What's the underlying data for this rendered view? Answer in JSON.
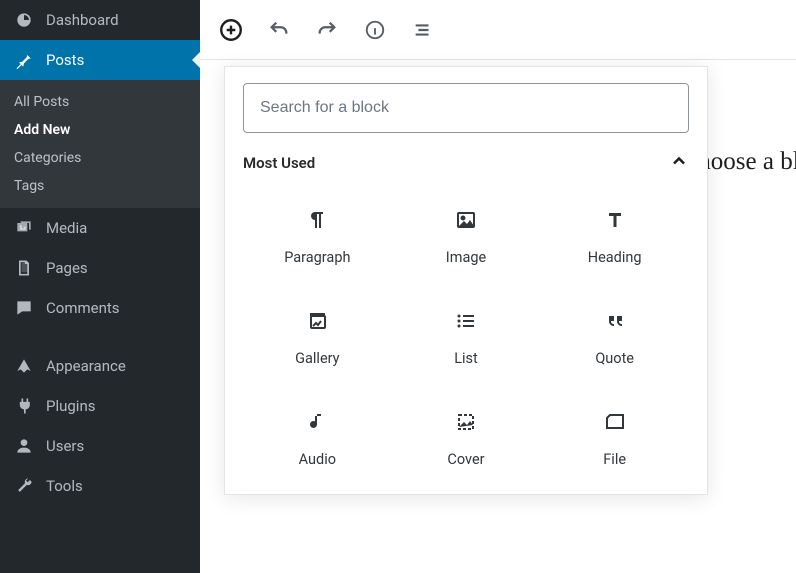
{
  "sidebar": {
    "items": [
      {
        "label": "Dashboard",
        "iname": "dashboard-icon"
      },
      {
        "label": "Posts",
        "iname": "pin-icon"
      },
      {
        "label": "Media",
        "iname": "media-icon"
      },
      {
        "label": "Pages",
        "iname": "pages-icon"
      },
      {
        "label": "Comments",
        "iname": "comments-icon"
      },
      {
        "label": "Appearance",
        "iname": "appearance-icon"
      },
      {
        "label": "Plugins",
        "iname": "plugins-icon"
      },
      {
        "label": "Users",
        "iname": "users-icon"
      },
      {
        "label": "Tools",
        "iname": "tools-icon"
      }
    ],
    "submenu": {
      "items": [
        {
          "label": "All Posts"
        },
        {
          "label": "Add New"
        },
        {
          "label": "Categories"
        },
        {
          "label": "Tags"
        }
      ]
    }
  },
  "editor": {
    "background_text": "Start writing or type / to choose a block",
    "search_placeholder": "Search for a block",
    "section_title": "Most Used",
    "blocks": [
      {
        "label": "Paragraph",
        "iname": "paragraph-icon"
      },
      {
        "label": "Image",
        "iname": "image-icon"
      },
      {
        "label": "Heading",
        "iname": "heading-icon"
      },
      {
        "label": "Gallery",
        "iname": "gallery-icon"
      },
      {
        "label": "List",
        "iname": "list-icon"
      },
      {
        "label": "Quote",
        "iname": "quote-icon"
      },
      {
        "label": "Audio",
        "iname": "audio-icon"
      },
      {
        "label": "Cover",
        "iname": "cover-icon"
      },
      {
        "label": "File",
        "iname": "file-icon"
      }
    ]
  }
}
